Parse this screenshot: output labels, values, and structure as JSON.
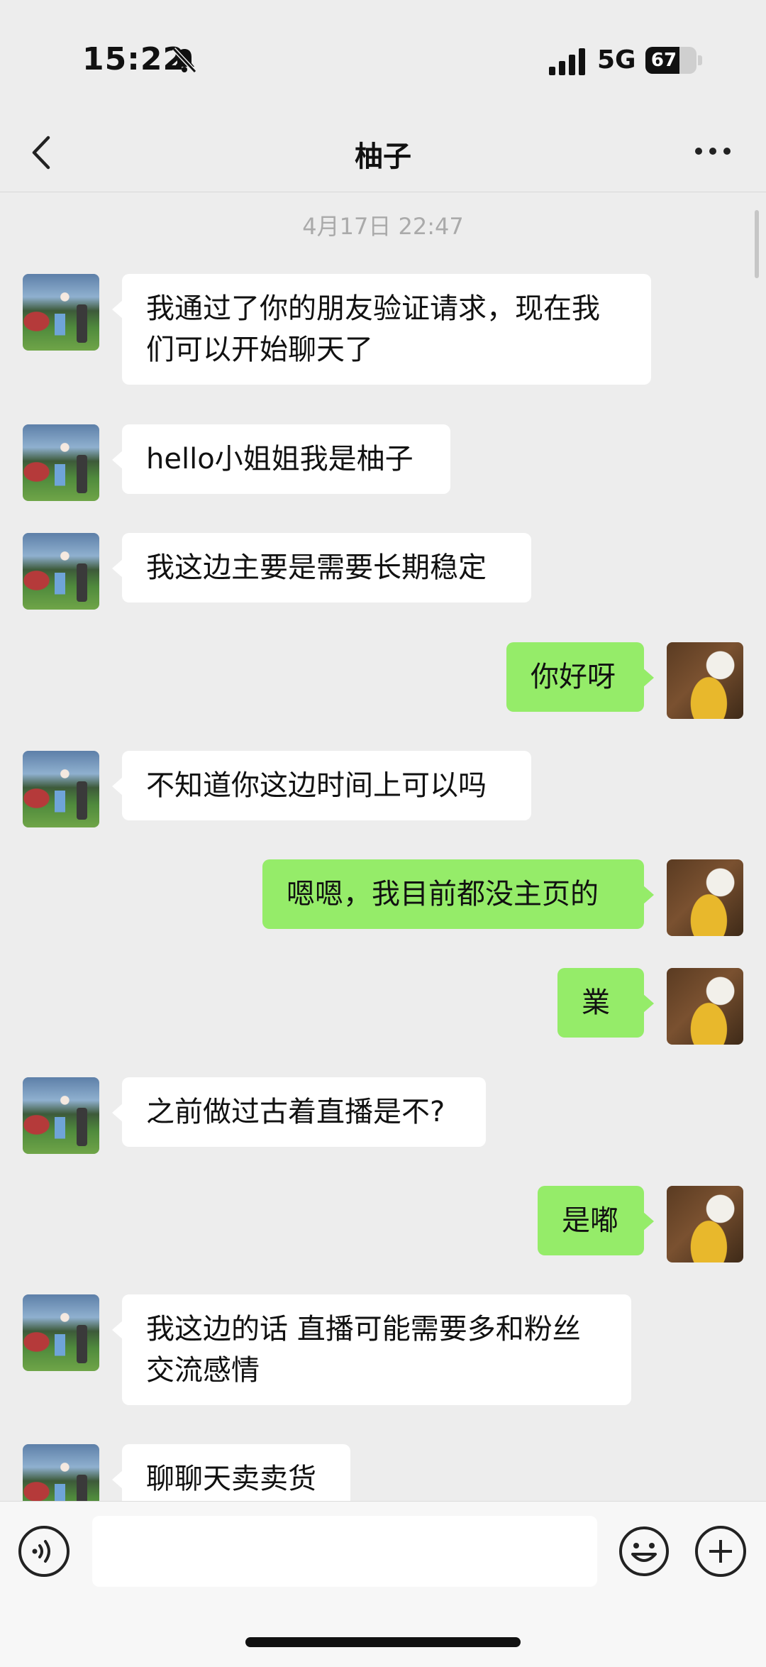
{
  "status_bar": {
    "time": "15:22",
    "network": "5G",
    "battery": "67",
    "battery_level": 0.67,
    "icons": [
      "bell-muted-icon",
      "signal-icon",
      "battery-icon"
    ]
  },
  "nav": {
    "title": "柚子",
    "back_icon": "chevron-left-icon",
    "more_icon": "more-dots-icon"
  },
  "chat": {
    "timestamp": "4月17日 22:47",
    "messages": [
      {
        "side": "left",
        "lines": [
          "我通过了你的朋友验证请求，现在我",
          "们可以开始聊天了"
        ]
      },
      {
        "side": "left",
        "lines": [
          "hello小姐姐我是柚子"
        ]
      },
      {
        "side": "left",
        "lines": [
          "我这边主要是需要长期稳定"
        ]
      },
      {
        "side": "right",
        "lines": [
          "你好呀"
        ]
      },
      {
        "side": "left",
        "lines": [
          "不知道你这边时间上可以吗"
        ]
      },
      {
        "side": "right",
        "lines": [
          "嗯嗯，我目前都没主页的"
        ]
      },
      {
        "side": "right",
        "lines": [
          "業"
        ]
      },
      {
        "side": "left",
        "lines": [
          "之前做过古着直播是不?"
        ]
      },
      {
        "side": "right",
        "lines": [
          "是嘟"
        ]
      },
      {
        "side": "left",
        "lines": [
          "我这边的话 直播可能需要多和粉丝",
          "交流感情"
        ]
      },
      {
        "side": "left",
        "lines": [
          "聊聊天卖卖货"
        ]
      }
    ]
  },
  "input_bar": {
    "value": "",
    "icons": [
      "voice-icon",
      "emoji-icon",
      "plus-icon"
    ]
  },
  "colors": {
    "background": "#ededed",
    "bubble_self": "#95ec69",
    "bubble_other": "#ffffff"
  }
}
